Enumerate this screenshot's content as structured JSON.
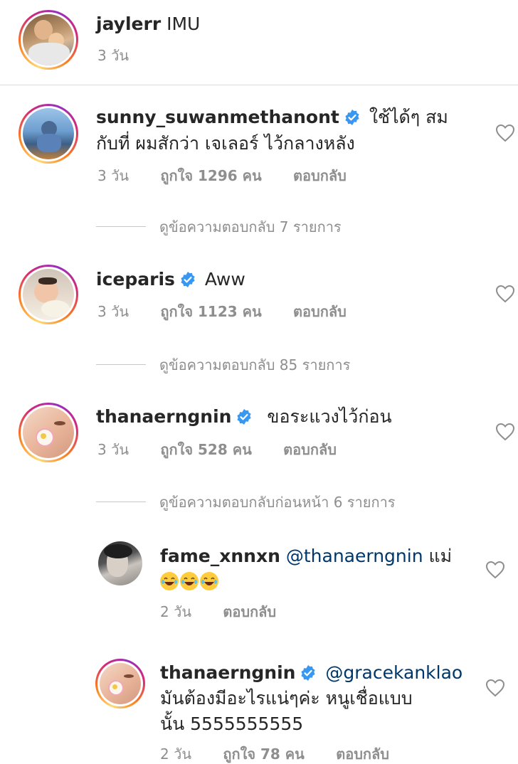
{
  "caption": {
    "username": "jaylerr",
    "text": "IMU",
    "time": "3 วัน"
  },
  "comments": [
    {
      "username": "sunny_suwanmethanont",
      "text_line1": "ใช้ได้ๆ สม",
      "text_line2": "กับที่ ผมสักว่า เจเลอร์ ไว้กลางหลัง",
      "time": "3 วัน",
      "likes": "ถูกใจ 1296 คน",
      "reply": "ตอบกลับ",
      "view_replies": "ดูข้อความตอบกลับ 7 รายการ"
    },
    {
      "username": "iceparis",
      "text_line1": "Aww",
      "time": "3 วัน",
      "likes": "ถูกใจ 1123 คน",
      "reply": "ตอบกลับ",
      "view_replies": "ดูข้อความตอบกลับ 85 รายการ"
    },
    {
      "username": "thanaerngnin",
      "text_line1": "ขอระแวงไว้ก่อน",
      "time": "3 วัน",
      "likes": "ถูกใจ 528 คน",
      "reply": "ตอบกลับ",
      "view_replies": "ดูข้อความตอบกลับก่อนหน้า 6 รายการ"
    }
  ],
  "replies": [
    {
      "username": "fame_xnnxn",
      "mention": "@thanaerngnin",
      "text_line1": "แม่",
      "emoji_count": "😂😂😂",
      "time": "2 วัน",
      "reply": "ตอบกลับ"
    },
    {
      "username": "thanaerngnin",
      "mention": "@gracekanklao",
      "text_line1": "มันต้องมีอะไรแน่ๆค่ะ หนูเชื่อแบบ",
      "text_line2": "นั้น 5555555555",
      "time": "2 วัน",
      "likes": "ถูกใจ 78 คน",
      "reply": "ตอบกลับ"
    }
  ],
  "colors": {
    "verified": "#3897f0",
    "mention": "#00376b",
    "muted": "#8e8e8e"
  },
  "icons": {
    "like": "heart-outline-icon",
    "verified": "verified-badge-icon"
  }
}
